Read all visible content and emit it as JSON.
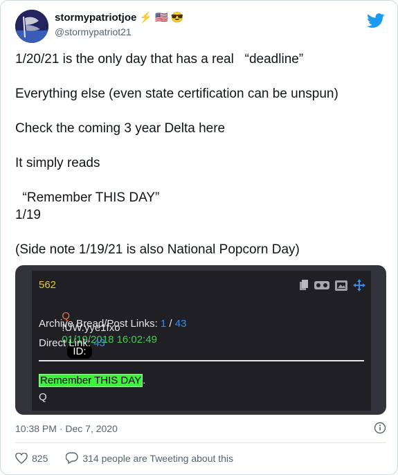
{
  "tweet": {
    "display_name": "stormypatriotjoe",
    "name_emojis": [
      "⚡",
      "🇺🇸",
      "😎"
    ],
    "handle": "@stormypatriot21",
    "text_lines": [
      "1/20/21 is the only day that has a real   “deadline”",
      "Everything else (even state certification can be unspun)",
      "Check the coming 3 year Delta here",
      "It simply reads",
      "  “Remember THIS DAY”",
      "1/19",
      "(Side note 1/19/21 is also National Popcorn Day)"
    ],
    "timestamp": "10:38 PM · Dec 7, 2020",
    "like_count": "825",
    "conversation_text": "314 people are Tweeting about this"
  },
  "embed": {
    "post_number": "562",
    "q_label": "Q",
    "tripcode": "!UW.yye1fxo",
    "post_datetime": "01/19/2018 16:02:49",
    "id_label": "ID:",
    "archive_label": "Archive Bread/Post Links:",
    "archive_link_1": "1",
    "archive_sep": " / ",
    "archive_link_2": "43",
    "direct_label": "Direct Link:",
    "direct_link": "43",
    "highlight_text": "Remember THIS DAY",
    "highlight_suffix": ".",
    "signature": "Q"
  },
  "colors": {
    "twitter_blue": "#1d9bf0",
    "embed_bg": "#33333c",
    "highlight_green": "#3df23d"
  }
}
